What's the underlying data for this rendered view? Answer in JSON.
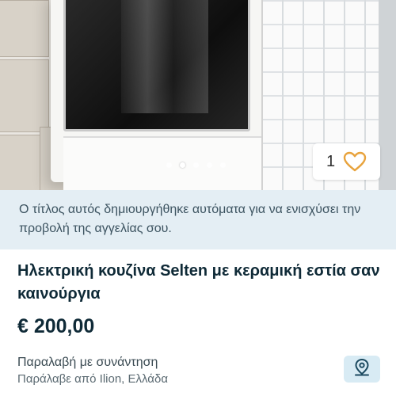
{
  "gallery": {
    "favorite_count": "1",
    "favorite_icon": "heart-outline-icon",
    "total_images": 5,
    "active_image": 2
  },
  "notice": {
    "text": "Ο τίτλος αυτός δημιουργήθηκε αυτόματα για να ενισχύσει την προβολή της αγγελίας σου."
  },
  "listing": {
    "title": "Ηλεκτρική κουζίνα Selten με κεραμική εστία σαν καινούργια",
    "price": "€ 200,00",
    "delivery_method": "Παραλαβή με συνάντηση",
    "pickup_location": "Παράλαβε από Ilion, Ελλάδα"
  },
  "map_button": {
    "icon": "map-pin-icon"
  },
  "colors": {
    "accent": "#e8a33d",
    "notice_bg": "#e4eef4",
    "title_text": "#0f2a37",
    "map_button_bg": "#d8ebf4"
  }
}
